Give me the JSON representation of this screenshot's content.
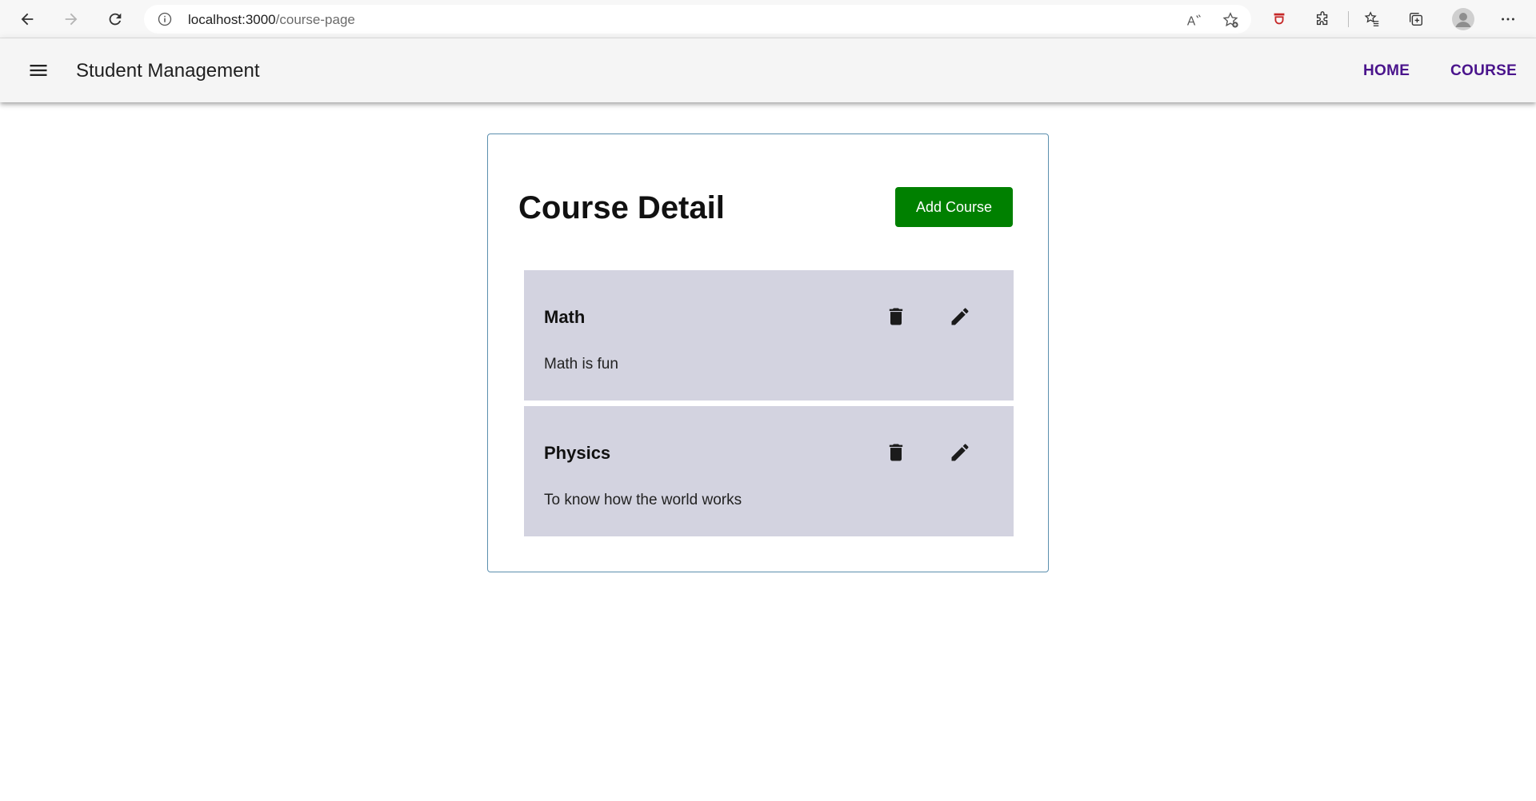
{
  "browser": {
    "url_host": "localhost:3000",
    "url_path": "/course-page",
    "icons": {
      "back": "arrow-left-icon",
      "forward": "arrow-right-icon",
      "refresh": "refresh-icon",
      "info": "info-icon",
      "read_aloud": "read-aloud-icon",
      "favorite": "star-add-icon",
      "extension_red": "shield-extension-icon",
      "extensions": "puzzle-icon",
      "favorites": "favorites-list-icon",
      "collections": "collections-icon",
      "profile": "profile-avatar-icon",
      "more": "more-dots-icon"
    }
  },
  "app_bar": {
    "title": "Student Management",
    "nav": {
      "home": "HOME",
      "course": "COURSE"
    },
    "nav_color": "#4a148c"
  },
  "main": {
    "title": "Course Detail",
    "add_button_label": "Add Course",
    "add_button_color": "#008000",
    "courses": [
      {
        "name": "Math",
        "description": "Math is fun"
      },
      {
        "name": "Physics",
        "description": "To know how the world works"
      }
    ]
  }
}
